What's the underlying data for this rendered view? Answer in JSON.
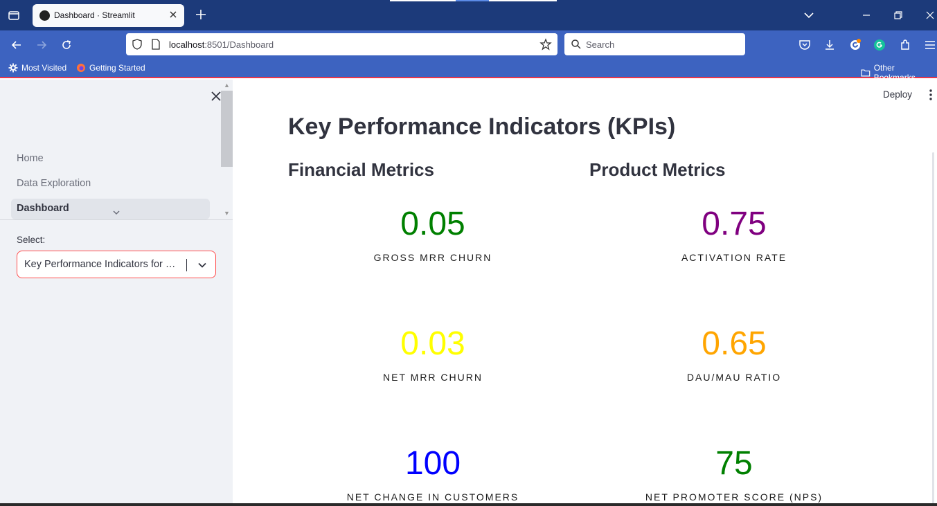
{
  "browser": {
    "tab_title": "Dashboard · Streamlit",
    "url_host": "localhost",
    "url_path": ":8501/Dashboard",
    "search_placeholder": "Search",
    "bookmarks": [
      "Most Visited",
      "Getting Started"
    ],
    "other_bookmarks": "Other Bookmarks"
  },
  "sidebar": {
    "nav_items": [
      "Home",
      "Data Exploration",
      "Dashboard"
    ],
    "active_index": 2,
    "select_label": "Select:",
    "select_value": "Key Performance Indicators for …"
  },
  "header": {
    "deploy_label": "Deploy"
  },
  "main": {
    "title": "Key Performance Indicators (KPIs)",
    "financial_title": "Financial Metrics",
    "product_title": "Product Metrics",
    "financial_metrics": [
      {
        "value": "0.05",
        "label": "GROSS MRR CHURN",
        "color": "#008000"
      },
      {
        "value": "0.03",
        "label": "NET MRR CHURN",
        "color": "#ffff00"
      },
      {
        "value": "100",
        "label": "NET CHANGE IN CUSTOMERS",
        "color": "#0000ff"
      }
    ],
    "product_metrics": [
      {
        "value": "0.75",
        "label": "ACTIVATION RATE",
        "color": "#800080"
      },
      {
        "value": "0.65",
        "label": "DAU/MAU RATIO",
        "color": "#ffa500"
      },
      {
        "value": "75",
        "label": "NET PROMOTER SCORE (NPS)",
        "color": "#008000"
      }
    ]
  }
}
